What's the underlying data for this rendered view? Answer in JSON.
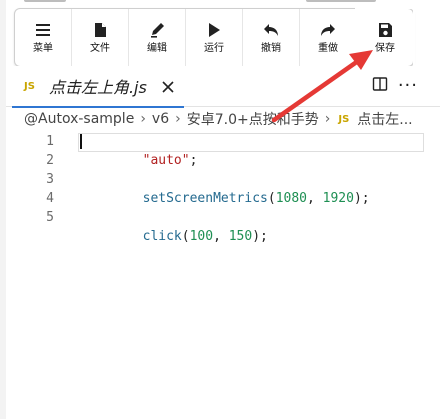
{
  "toolbar": {
    "buttons": [
      {
        "label": "菜单",
        "icon": "menu-icon"
      },
      {
        "label": "文件",
        "icon": "file-icon"
      },
      {
        "label": "编辑",
        "icon": "edit-icon"
      },
      {
        "label": "运行",
        "icon": "play-icon"
      },
      {
        "label": "撤销",
        "icon": "undo-icon"
      },
      {
        "label": "重做",
        "icon": "redo-icon"
      },
      {
        "label": "保存",
        "icon": "save-icon"
      }
    ]
  },
  "tab": {
    "badge": "JS",
    "title": "点击左上角.js",
    "close_icon": "close-icon"
  },
  "tab_actions": {
    "split_icon": "split-view-icon",
    "more": "···"
  },
  "breadcrumb": {
    "items": [
      "@Autox-sample",
      "v6",
      "安卓7.0+点按和手势"
    ],
    "badge": "JS",
    "file": "点击左..."
  },
  "editor": {
    "lines": [
      {
        "num": "1",
        "tokens": [
          {
            "t": "\"auto\"",
            "c": "str"
          },
          {
            "t": ";",
            "c": "punc"
          }
        ]
      },
      {
        "num": "2",
        "tokens": []
      },
      {
        "num": "3",
        "tokens": [
          {
            "t": "setScreenMetrics",
            "c": "fn"
          },
          {
            "t": "(",
            "c": "punc"
          },
          {
            "t": "1080",
            "c": "num"
          },
          {
            "t": ", ",
            "c": "punc"
          },
          {
            "t": "1920",
            "c": "num"
          },
          {
            "t": ");",
            "c": "punc"
          }
        ]
      },
      {
        "num": "4",
        "tokens": []
      },
      {
        "num": "5",
        "tokens": [
          {
            "t": "click",
            "c": "fn"
          },
          {
            "t": "(",
            "c": "punc"
          },
          {
            "t": "100",
            "c": "num"
          },
          {
            "t": ", ",
            "c": "punc"
          },
          {
            "t": "150",
            "c": "num"
          },
          {
            "t": ");",
            "c": "punc"
          }
        ]
      }
    ]
  },
  "colors": {
    "accent": "#2f76d2",
    "arrow": "#e53935",
    "js_badge": "#c9a500"
  }
}
